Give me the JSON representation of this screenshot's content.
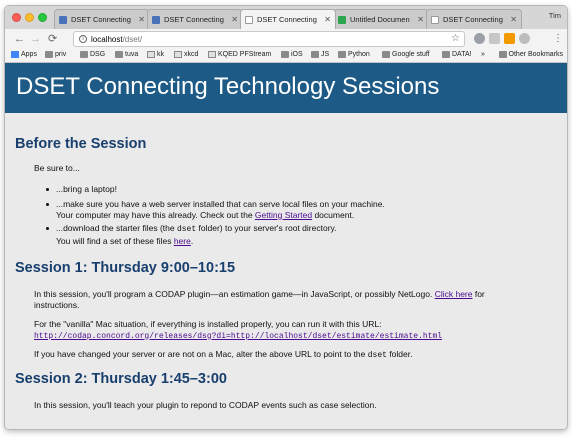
{
  "browser": {
    "tabs": [
      {
        "title": "DSET Connecting",
        "favicon": "doc-icon",
        "active": false
      },
      {
        "title": "DSET Connecting",
        "favicon": "doc-icon",
        "active": false
      },
      {
        "title": "DSET Connecting",
        "favicon": "blank-page-icon",
        "active": true
      },
      {
        "title": "Untitled Documen",
        "favicon": "codap-icon",
        "active": false
      },
      {
        "title": "DSET Connecting",
        "favicon": "blank-page-icon",
        "active": false
      }
    ],
    "profile_name": "Tim",
    "url_host": "localhost",
    "url_path": "/dset/",
    "bookmarks": [
      {
        "label": "Apps",
        "icon": "apps-grid-icon"
      },
      {
        "label": "priv",
        "icon": "folder-icon"
      },
      {
        "label": "DSG",
        "icon": "folder-icon"
      },
      {
        "label": "tuva",
        "icon": "folder-icon"
      },
      {
        "label": "kk",
        "icon": "site-icon"
      },
      {
        "label": "xkcd",
        "icon": "site-icon"
      },
      {
        "label": "KQED PFStream",
        "icon": "site-icon"
      },
      {
        "label": "iOS",
        "icon": "folder-icon"
      },
      {
        "label": "JS",
        "icon": "folder-icon"
      },
      {
        "label": "Python",
        "icon": "folder-icon"
      },
      {
        "label": "Google stuff",
        "icon": "folder-icon"
      },
      {
        "label": "DATA!",
        "icon": "folder-icon"
      }
    ],
    "more_bookmarks": "»",
    "other_bookmarks": "Other Bookmarks"
  },
  "page": {
    "banner_title": "DSET Connecting Technology Sessions",
    "before": {
      "heading": "Before the Session",
      "intro": "Be sure to...",
      "item1": "...bring a laptop!",
      "item2_line1": "...make sure you have a web server installed that can serve local files on your machine.",
      "item2_line2_pre": "Your computer may have this already. Check out the ",
      "item2_link": "Getting Started",
      "item2_line2_post": " document.",
      "item3_pre": "...download the starter files (the ",
      "item3_code": "dset",
      "item3_post": " folder) to your server's root directory.",
      "item3_line2_pre": "You will find a set of these files ",
      "item3_link": "here",
      "item3_line2_post": "."
    },
    "session1": {
      "heading": "Session 1: Thursday 9:00–10:15",
      "para1_line1_pre": "In this session, you'll program a CODAP plugin—an estimation game—in JavaScript, or possibly NetLogo. ",
      "para1_link": "Click here",
      "para1_line1_post": " for",
      "para1_line2": "instructions.",
      "para2_line1": "For the \"vanilla\" Mac situation, if everything is installed properly, you can run it with this URL:",
      "para2_url": "http://codap.concord.org/releases/dsg?di=http://localhost/dset/estimate/estimate.html",
      "para3_pre": "If you have changed your server or are not on a Mac, alter the above URL to point to the ",
      "para3_code": "dset",
      "para3_post": " folder."
    },
    "session2": {
      "heading": "Session 2: Thursday 1:45–3:00",
      "para1": "In this session, you'll teach your plugin to repond to CODAP events such as case selection."
    }
  }
}
